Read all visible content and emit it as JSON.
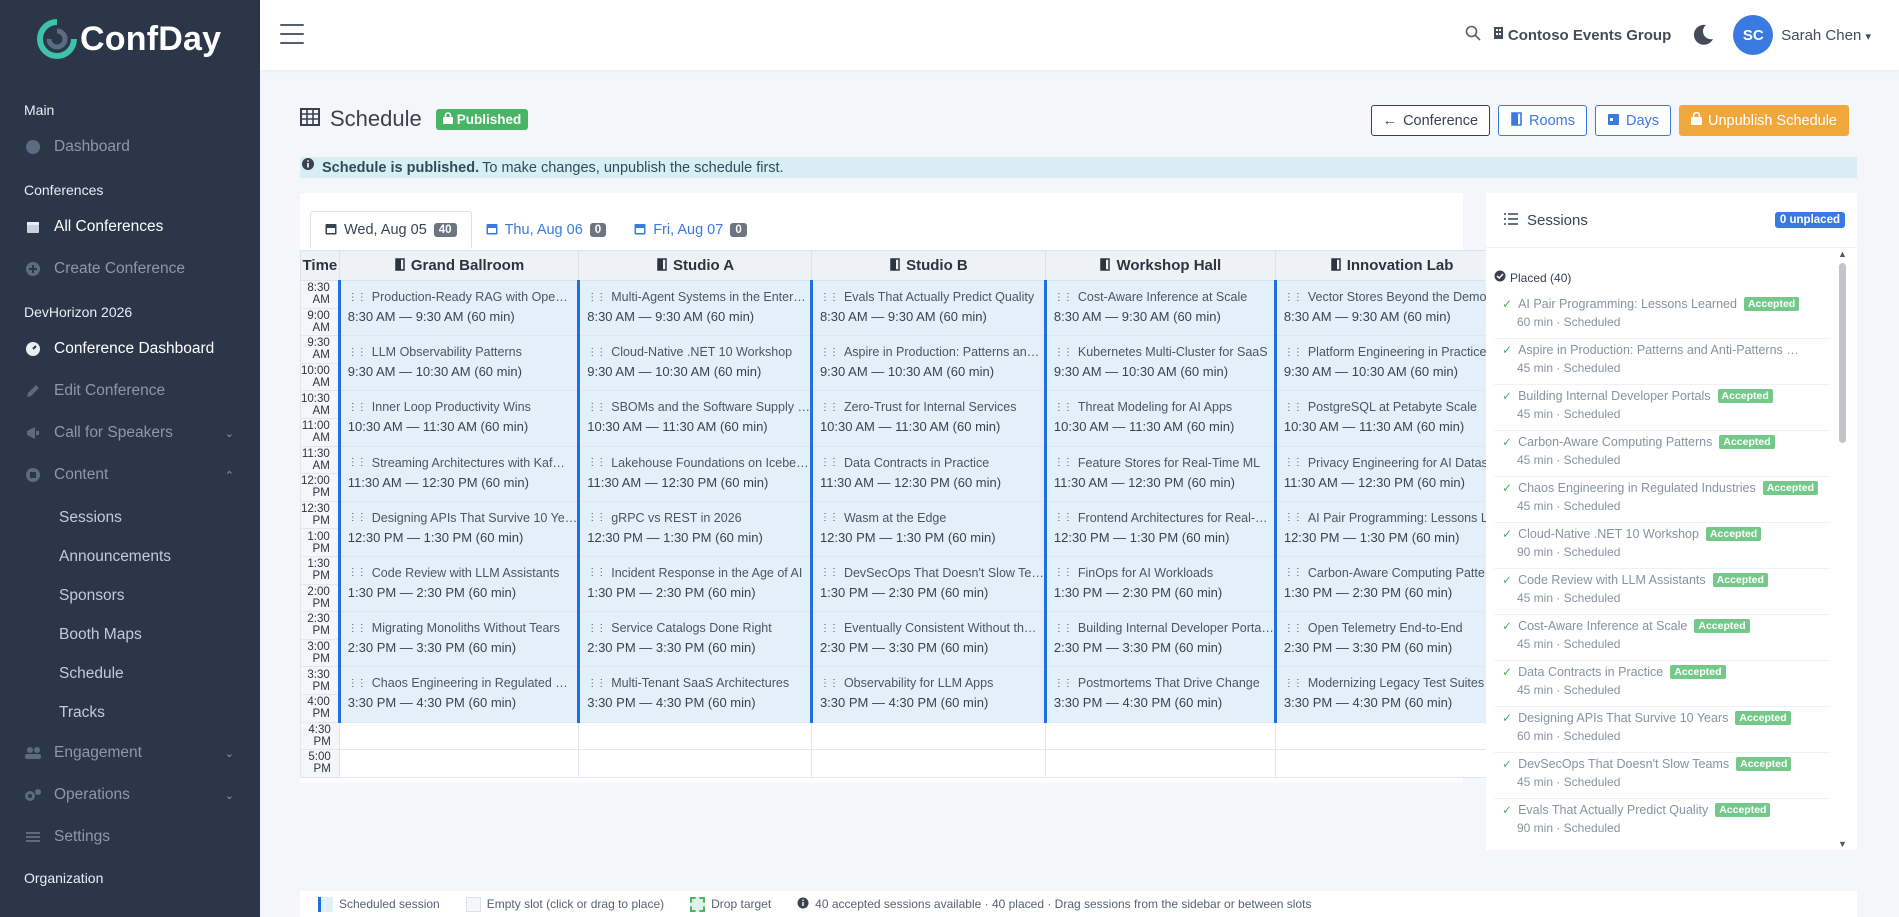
{
  "app": {
    "name": "ConfDay"
  },
  "colors": {
    "sidebar_bg": "#2b3649",
    "accent": "#3a7ae0",
    "success": "#49b366",
    "warning": "#f0a83d",
    "slot_bg": "#e3f0fa",
    "slot_border": "#1f6fde"
  },
  "sidebar": {
    "main_label": "Main",
    "dashboard": "Dashboard",
    "conferences_label": "Conferences",
    "all_conferences": "All Conferences",
    "create_conference": "Create Conference",
    "devhorizon_label": "DevHorizon 2026",
    "conference_dashboard": "Conference Dashboard",
    "edit_conference": "Edit Conference",
    "call_for_speakers": "Call for Speakers",
    "content": "Content",
    "content_items": [
      "Sessions",
      "Announcements",
      "Sponsors",
      "Booth Maps",
      "Schedule",
      "Tracks"
    ],
    "engagement": "Engagement",
    "operations": "Operations",
    "settings": "Settings",
    "organization_label": "Organization"
  },
  "topbar": {
    "org_name": "Contoso Events Group",
    "avatar_initials": "SC",
    "user_name": "Sarah Chen"
  },
  "page": {
    "title": "Schedule",
    "status_badge": "Published",
    "buttons": {
      "conference": "Conference",
      "rooms": "Rooms",
      "days": "Days",
      "unpublish": "Unpublish Schedule"
    },
    "alert_bold": "Schedule is published.",
    "alert_text": "To make changes, unpublish the schedule first."
  },
  "days": [
    {
      "label": "Wed, Aug 05",
      "count": "40"
    },
    {
      "label": "Thu, Aug 06",
      "count": "0"
    },
    {
      "label": "Fri, Aug 07",
      "count": "0"
    }
  ],
  "schedule": {
    "time_header": "Time",
    "rooms": [
      "Grand Ballroom",
      "Studio A",
      "Studio B",
      "Workshop Hall",
      "Innovation Lab"
    ],
    "times": [
      "8:30 AM",
      "9:00 AM",
      "9:30 AM",
      "10:00 AM",
      "10:30 AM",
      "11:00 AM",
      "11:30 AM",
      "12:00 PM",
      "12:30 PM",
      "1:00 PM",
      "1:30 PM",
      "2:00 PM",
      "2:30 PM",
      "3:00 PM",
      "3:30 PM",
      "4:00 PM",
      "4:30 PM",
      "5:00 PM"
    ],
    "slot_times": [
      "8:30 AM — 9:30 AM (60 min)",
      "9:30 AM — 10:30 AM (60 min)",
      "10:30 AM — 11:30 AM (60 min)",
      "11:30 AM — 12:30 PM (60 min)",
      "12:30 PM — 1:30 PM (60 min)",
      "1:30 PM — 2:30 PM (60 min)",
      "2:30 PM — 3:30 PM (60 min)",
      "3:30 PM — 4:30 PM (60 min)"
    ],
    "sessions": [
      [
        "Production-Ready RAG with Ope…",
        "Multi-Agent Systems in the Enter…",
        "Evals That Actually Predict Quality",
        "Cost-Aware Inference at Scale",
        "Vector Stores Beyond the Demo"
      ],
      [
        "LLM Observability Patterns",
        "Cloud-Native .NET 10 Workshop",
        "Aspire in Production: Patterns an…",
        "Kubernetes Multi-Cluster for SaaS",
        "Platform Engineering in Practice"
      ],
      [
        "Inner Loop Productivity Wins",
        "SBOMs and the Software Supply …",
        "Zero-Trust for Internal Services",
        "Threat Modeling for AI Apps",
        "PostgreSQL at Petabyte Scale"
      ],
      [
        "Streaming Architectures with Kaf…",
        "Lakehouse Foundations on Icebe…",
        "Data Contracts in Practice",
        "Feature Stores for Real-Time ML",
        "Privacy Engineering for AI Datase…"
      ],
      [
        "Designing APIs That Survive 10 Ye…",
        "gRPC vs REST in 2026",
        "Wasm at the Edge",
        "Frontend Architectures for Real-…",
        "AI Pair Programming: Lessons Le…"
      ],
      [
        "Code Review with LLM Assistants",
        "Incident Response in the Age of AI",
        "DevSecOps That Doesn't Slow Te…",
        "FinOps for AI Workloads",
        "Carbon-Aware Computing Patte…"
      ],
      [
        "Migrating Monoliths Without Tears",
        "Service Catalogs Done Right",
        "Eventually Consistent Without th…",
        "Building Internal Developer Porta…",
        "Open Telemetry End-to-End"
      ],
      [
        "Chaos Engineering in Regulated …",
        "Multi-Tenant SaaS Architectures",
        "Observability for LLM Apps",
        "Postmortems That Drive Change",
        "Modernizing Legacy Test Suites"
      ]
    ]
  },
  "panel": {
    "title": "Sessions",
    "unplaced_badge": "0 unplaced",
    "placed_label": "Placed (40)",
    "accepted_label": "Accepted",
    "items": [
      {
        "title": "AI Pair Programming: Lessons Learned",
        "meta": "60 min · Scheduled",
        "badge": true
      },
      {
        "title": "Aspire in Production: Patterns and Anti-Patterns …",
        "meta": "45 min · Scheduled",
        "badge": false
      },
      {
        "title": "Building Internal Developer Portals",
        "meta": "45 min · Scheduled",
        "badge": true
      },
      {
        "title": "Carbon-Aware Computing Patterns",
        "meta": "45 min · Scheduled",
        "badge": true
      },
      {
        "title": "Chaos Engineering in Regulated Industries",
        "meta": "45 min · Scheduled",
        "badge": true
      },
      {
        "title": "Cloud-Native .NET 10 Workshop",
        "meta": "90 min · Scheduled",
        "badge": true
      },
      {
        "title": "Code Review with LLM Assistants",
        "meta": "45 min · Scheduled",
        "badge": true
      },
      {
        "title": "Cost-Aware Inference at Scale",
        "meta": "45 min · Scheduled",
        "badge": true
      },
      {
        "title": "Data Contracts in Practice",
        "meta": "45 min · Scheduled",
        "badge": true
      },
      {
        "title": "Designing APIs That Survive 10 Years",
        "meta": "60 min · Scheduled",
        "badge": true
      },
      {
        "title": "DevSecOps That Doesn't Slow Teams",
        "meta": "45 min · Scheduled",
        "badge": true
      },
      {
        "title": "Evals That Actually Predict Quality",
        "meta": "90 min · Scheduled",
        "badge": true
      }
    ]
  },
  "legend": {
    "scheduled": "Scheduled session",
    "empty": "Empty slot (click or drag to place)",
    "drop": "Drop target",
    "info": "40 accepted sessions available · 40 placed · Drag sessions from the sidebar or between slots"
  }
}
